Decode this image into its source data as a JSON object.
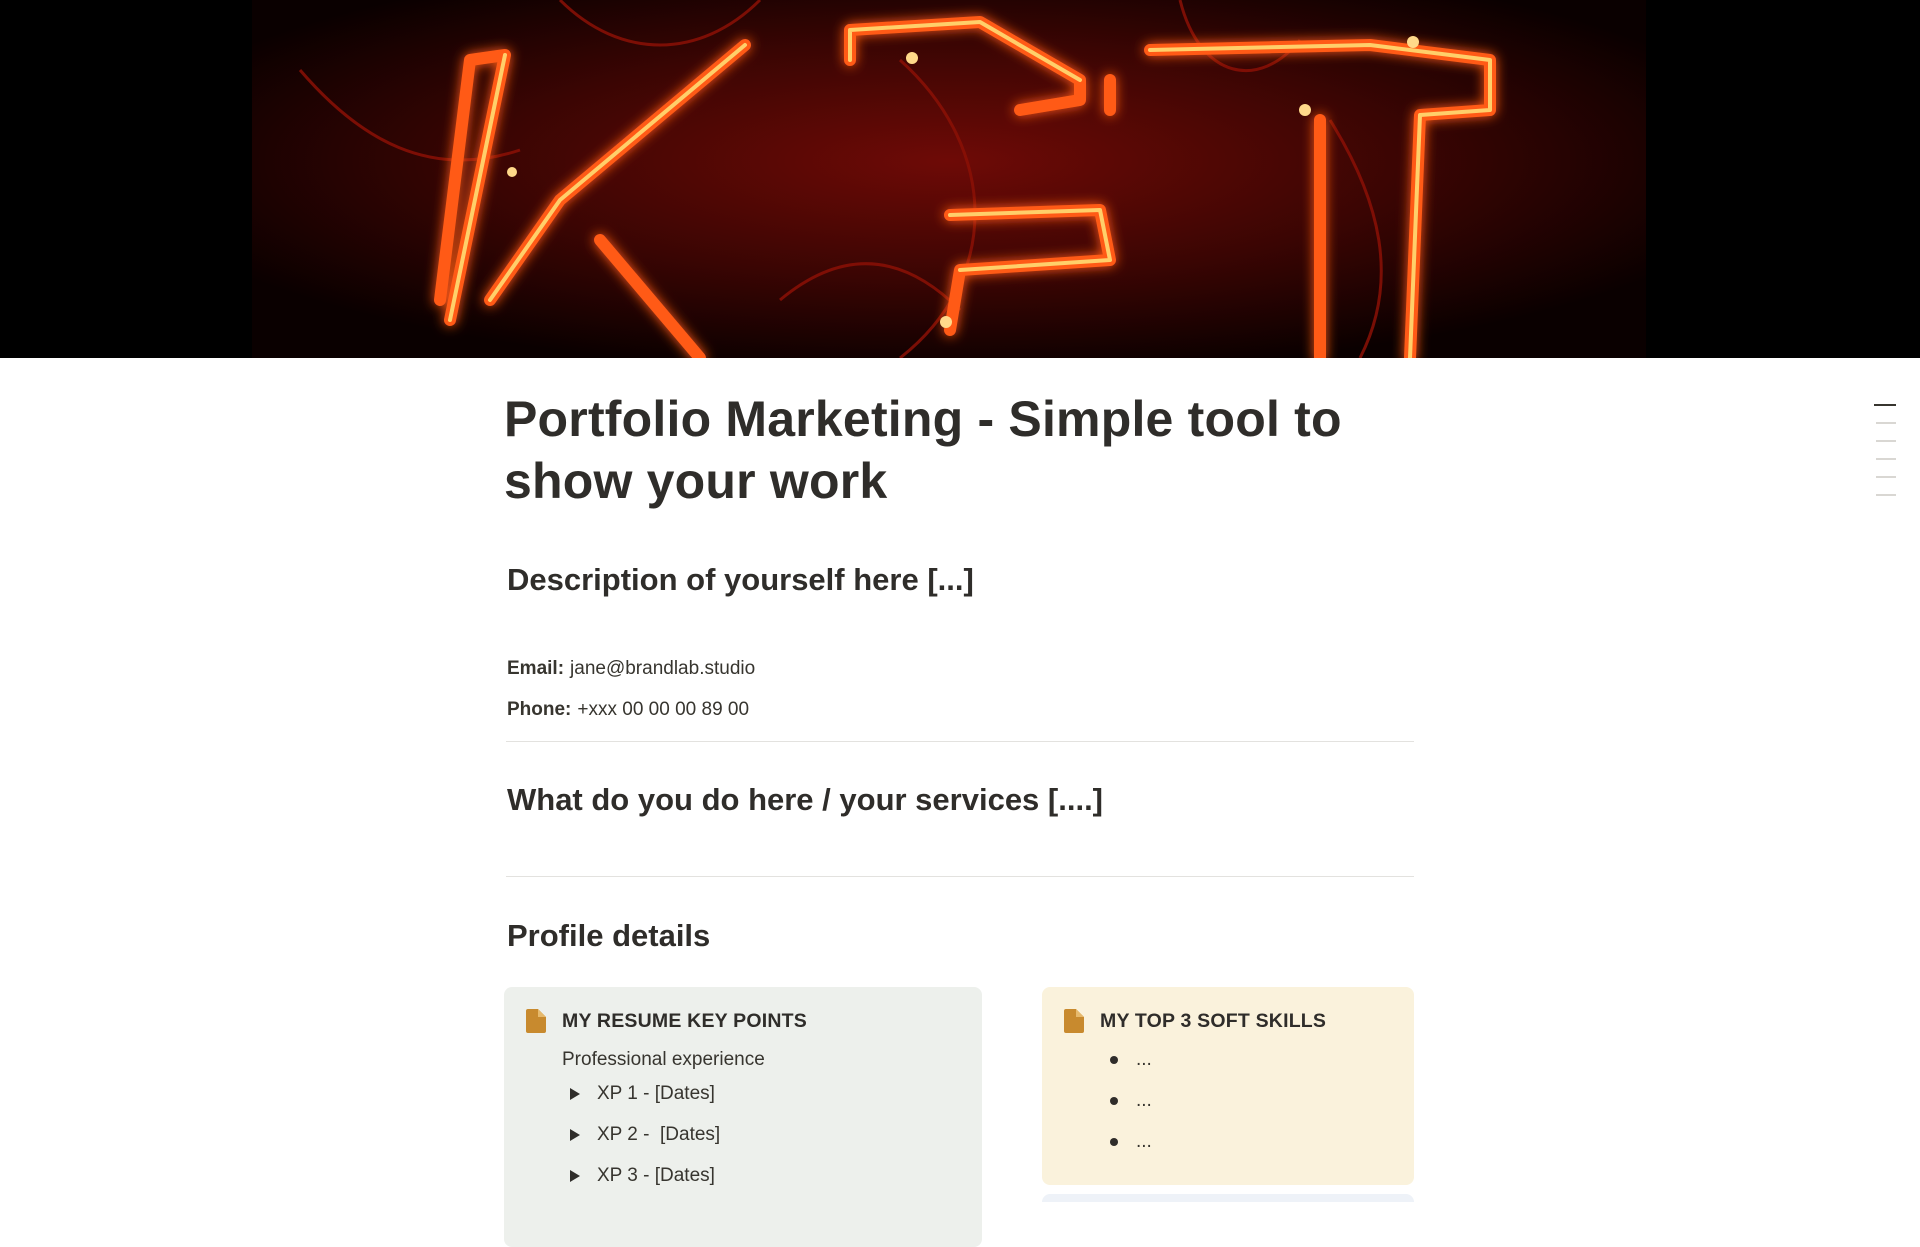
{
  "cover": {
    "image": "red-neon-sign-cover"
  },
  "page": {
    "title": "Portfolio Marketing - Simple tool to show your work"
  },
  "description": {
    "heading": "Description of yourself here [...]"
  },
  "contact": {
    "email_label": "Email:",
    "email_value": "jane@brandlab.studio",
    "phone_label": "Phone:",
    "phone_value": "+xxx 00 00 00 89 00"
  },
  "services": {
    "heading": "What do you do here / your services [....]"
  },
  "profile": {
    "heading": "Profile details",
    "resume_card": {
      "icon": "document-icon",
      "title": "MY RESUME KEY POINTS",
      "subtitle": "Professional experience",
      "toggles": [
        "XP 1 - [Dates]",
        "XP 2 -  [Dates]",
        "XP 3 - [Dates]"
      ],
      "background": "#edf0ec"
    },
    "skills_card": {
      "icon": "document-icon",
      "title": "MY TOP 3 SOFT SKILLS",
      "bullets": [
        "...",
        "...",
        "..."
      ],
      "background": "#faf2dc"
    }
  },
  "colors": {
    "icon_accent": "#c88a2e",
    "text": "#2f2d2a",
    "neon": "#ff4a12"
  }
}
